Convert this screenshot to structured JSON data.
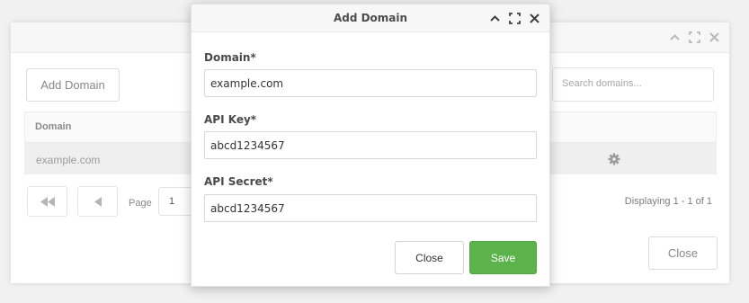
{
  "background_window": {
    "add_button_label": "Add Domain",
    "search_placeholder": "Search domains...",
    "table": {
      "columns": [
        "Domain"
      ],
      "rows": [
        {
          "domain": "example.com"
        }
      ]
    },
    "pager": {
      "page_label": "Page",
      "page_value": "1",
      "displaying": "Displaying 1 - 1 of 1"
    },
    "close_button_label": "Close"
  },
  "modal": {
    "title": "Add Domain",
    "fields": [
      {
        "label": "Domain*",
        "value": "example.com"
      },
      {
        "label": "API Key*",
        "value": "abcd1234567"
      },
      {
        "label": "API Secret*",
        "value": "abcd1234567"
      }
    ],
    "close_label": "Close",
    "save_label": "Save"
  },
  "colors": {
    "save_green": "#5cb34c",
    "icon_gray": "#b9b9b9"
  }
}
